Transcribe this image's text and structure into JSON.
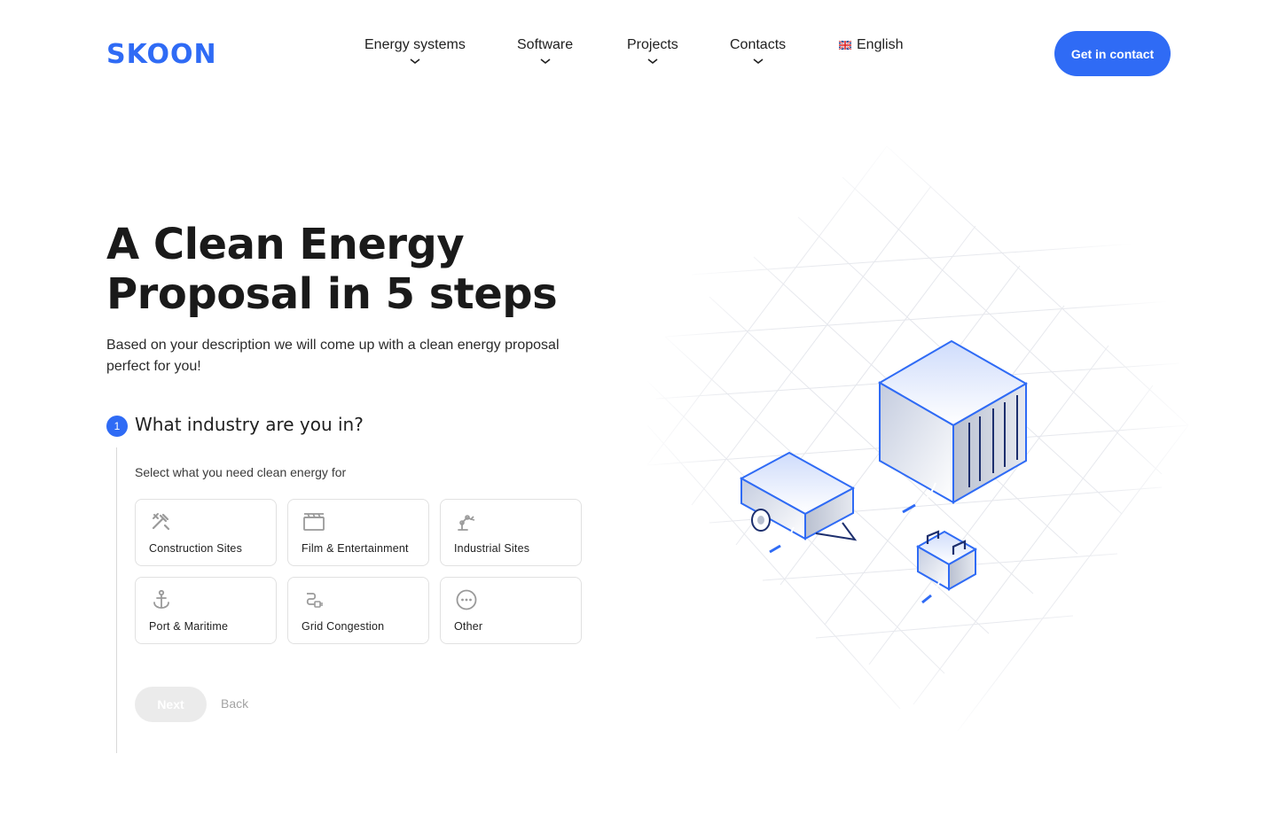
{
  "brand": {
    "logo": "SKOON",
    "accent": "#2f6bf5"
  },
  "nav": {
    "items": [
      {
        "label": "Energy systems"
      },
      {
        "label": "Software"
      },
      {
        "label": "Projects"
      },
      {
        "label": "Contacts"
      }
    ],
    "language": "English",
    "language_icon": "uk-flag-icon",
    "cta": "Get in contact"
  },
  "hero": {
    "title_line1": "A Clean Energy",
    "title_line2": "Proposal in 5 steps",
    "subtitle": "Based on your description we will come up with a clean energy proposal perfect for you!"
  },
  "step": {
    "number": "1",
    "title": "What industry are you in?",
    "hint": "Select what you need clean energy for",
    "options": [
      {
        "label": "Construction Sites",
        "icon": "tools-icon"
      },
      {
        "label": "Film & Entertainment",
        "icon": "clapperboard-icon"
      },
      {
        "label": "Industrial Sites",
        "icon": "robot-arm-icon"
      },
      {
        "label": "Port & Maritime",
        "icon": "anchor-icon"
      },
      {
        "label": "Grid Congestion",
        "icon": "plug-icon"
      },
      {
        "label": "Other",
        "icon": "more-icon"
      }
    ],
    "next": "Next",
    "back": "Back"
  }
}
